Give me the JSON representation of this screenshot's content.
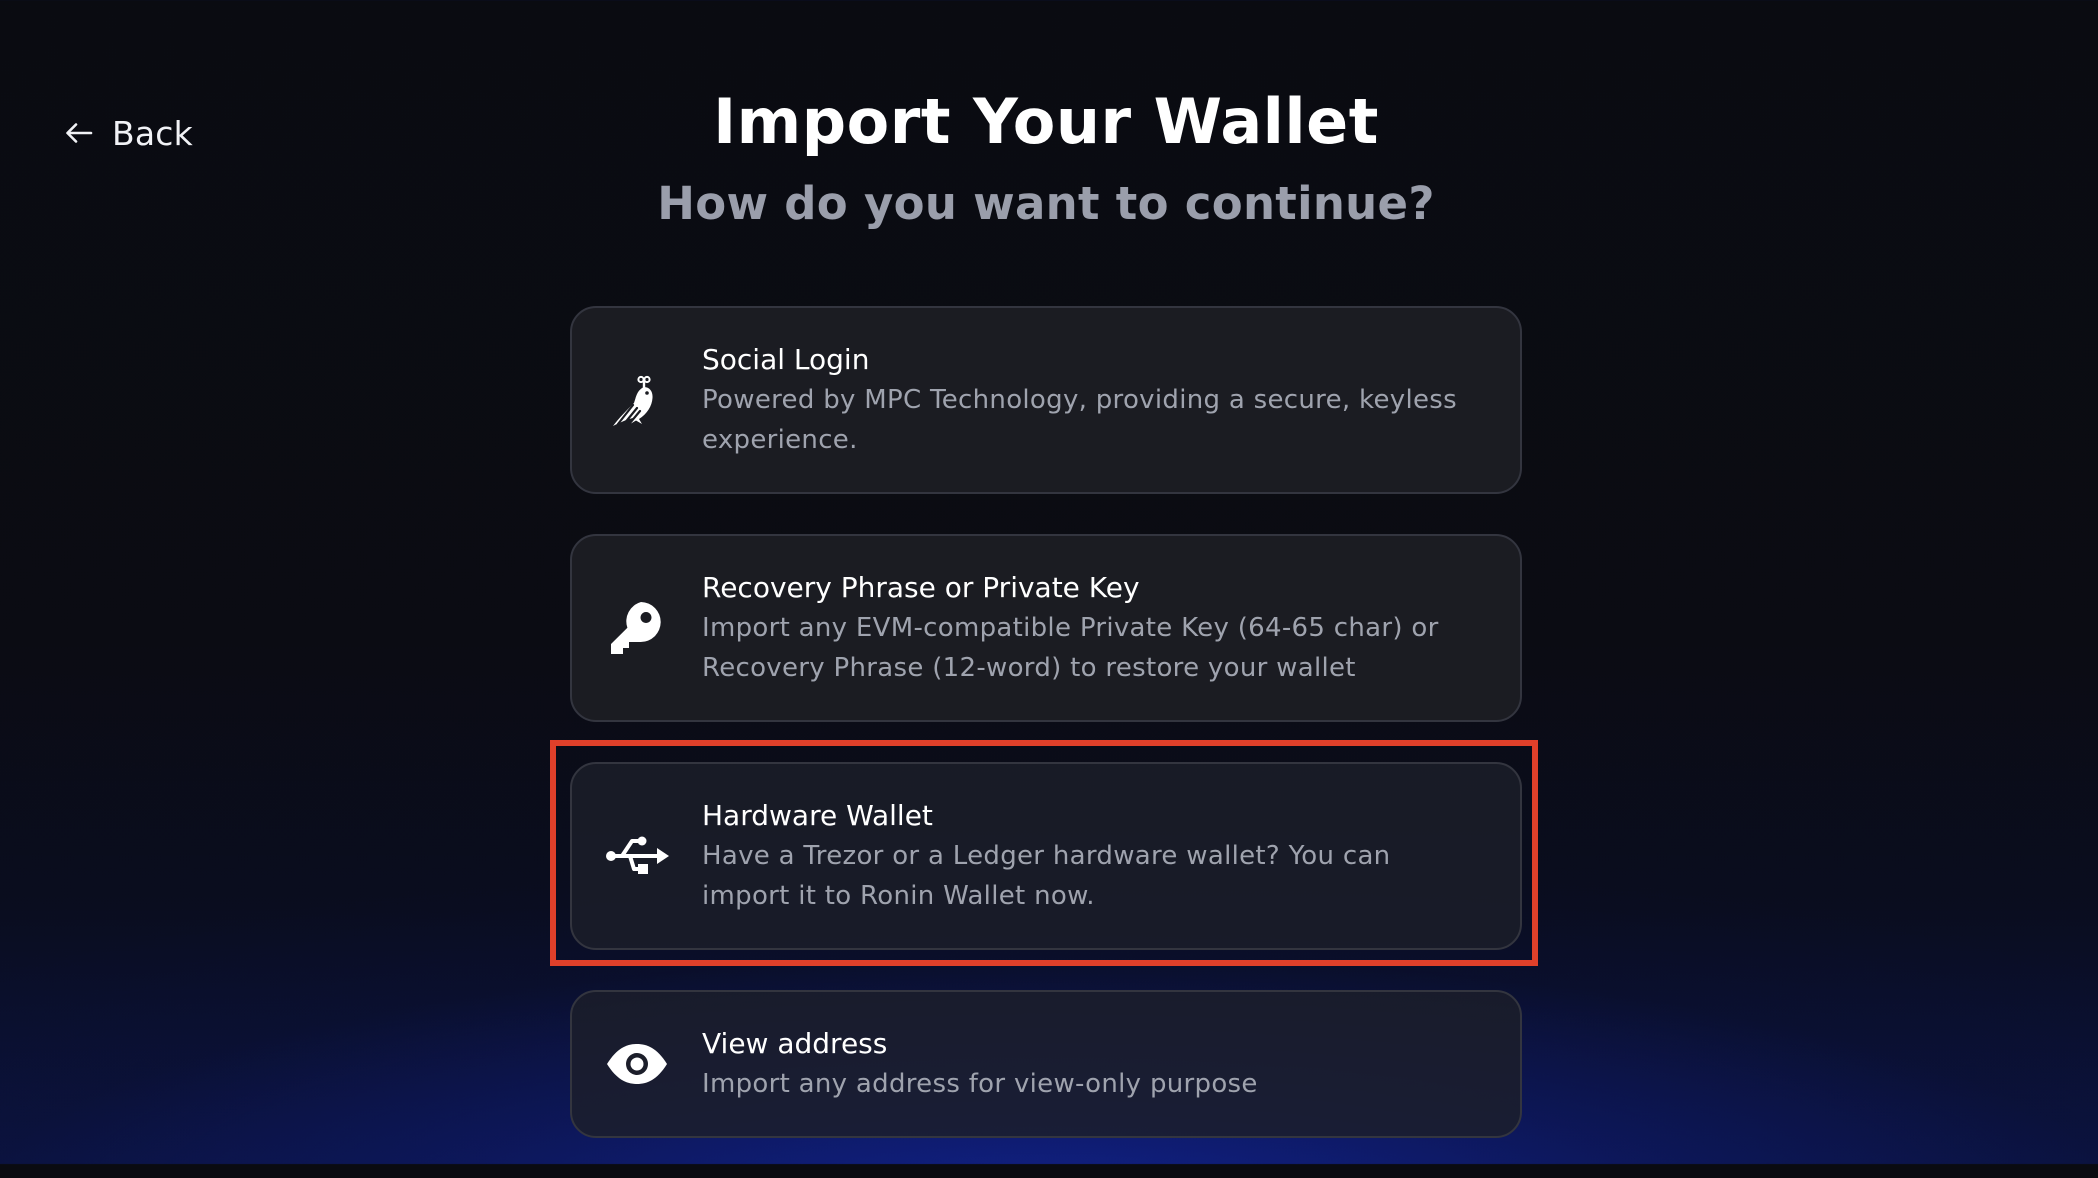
{
  "header": {
    "back_label": "Back",
    "title": "Import Your Wallet",
    "subtitle": "How do you want to continue?"
  },
  "options": [
    {
      "icon": "bird-icon",
      "title": "Social Login",
      "description": "Powered by MPC Technology, providing a secure, keyless experience."
    },
    {
      "icon": "key-icon",
      "title": "Recovery Phrase or Private Key",
      "description": "Import any EVM-compatible Private Key (64-65 char) or Recovery Phrase (12-word) to restore your wallet"
    },
    {
      "icon": "usb-icon",
      "title": "Hardware Wallet",
      "description": "Have a Trezor or a Ledger hardware wallet? You can import it to Ronin Wallet now.",
      "highlighted": true
    },
    {
      "icon": "eye-icon",
      "title": "View address",
      "description": "Import any address for view-only purpose"
    }
  ],
  "colors": {
    "background": "#0a0b11",
    "card_background": "#1b1c22",
    "card_border": "#33353f",
    "subtitle_text": "#9a9eab",
    "description_text": "#9fa3ae",
    "highlight": "#e0402a",
    "glow": "#1224a0"
  }
}
